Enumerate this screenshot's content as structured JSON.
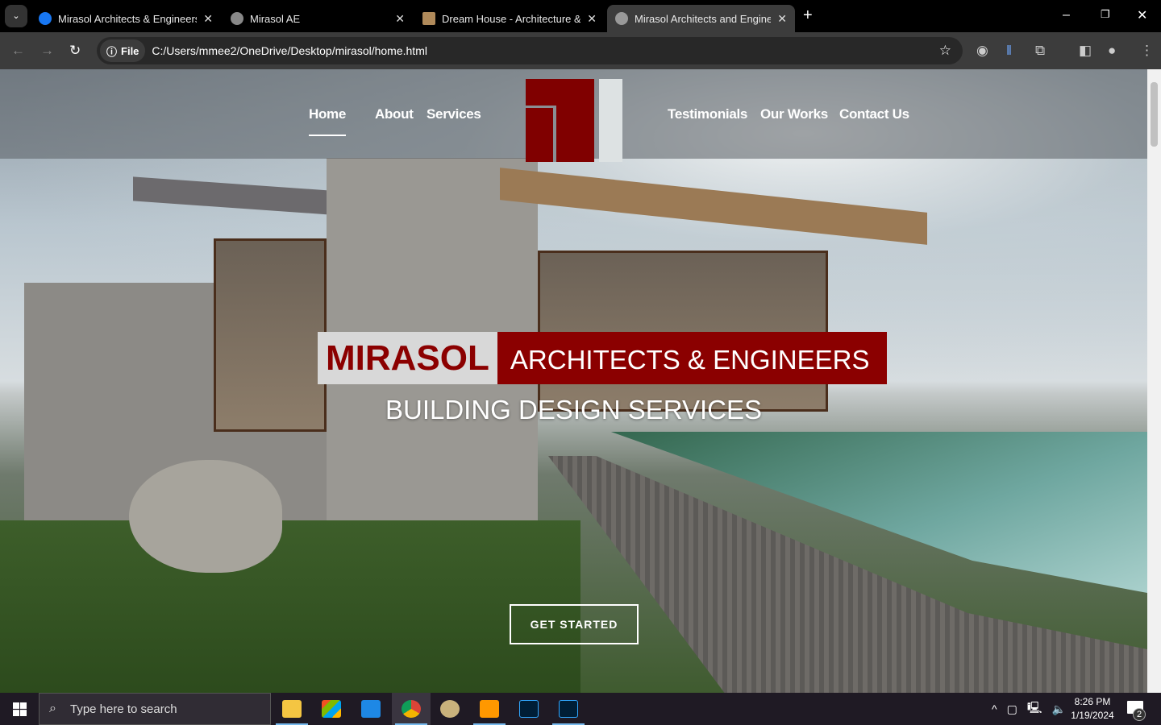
{
  "browser": {
    "tabs": [
      {
        "title": "Mirasol Architects & Engineers",
        "icon": "facebook-icon",
        "active": false
      },
      {
        "title": "Mirasol AE",
        "icon": "globe-icon",
        "active": false
      },
      {
        "title": "Dream House - Architecture &",
        "icon": "building-icon",
        "active": false
      },
      {
        "title": "Mirasol Architects and Engineers",
        "icon": "globe-icon",
        "active": true
      }
    ],
    "chip": "File",
    "url": "C:/Users/mmee2/OneDrive/Desktop/mirasol/home.html"
  },
  "site": {
    "nav": [
      "Home",
      "About",
      "Services",
      "Testimonials",
      "Our Works",
      "Contact Us"
    ],
    "active_nav": "Home",
    "brand_color": "#8b0000",
    "hero_mirasol": "MIRASOL",
    "hero_ae": "ARCHITECTS & ENGINEERS",
    "hero_sub": "BUILDING DESIGN SERVICES",
    "cta": "GET STARTED"
  },
  "taskbar": {
    "search_placeholder": "Type here to search",
    "time": "8:26 PM",
    "date": "1/19/2024",
    "notifications": "2"
  }
}
